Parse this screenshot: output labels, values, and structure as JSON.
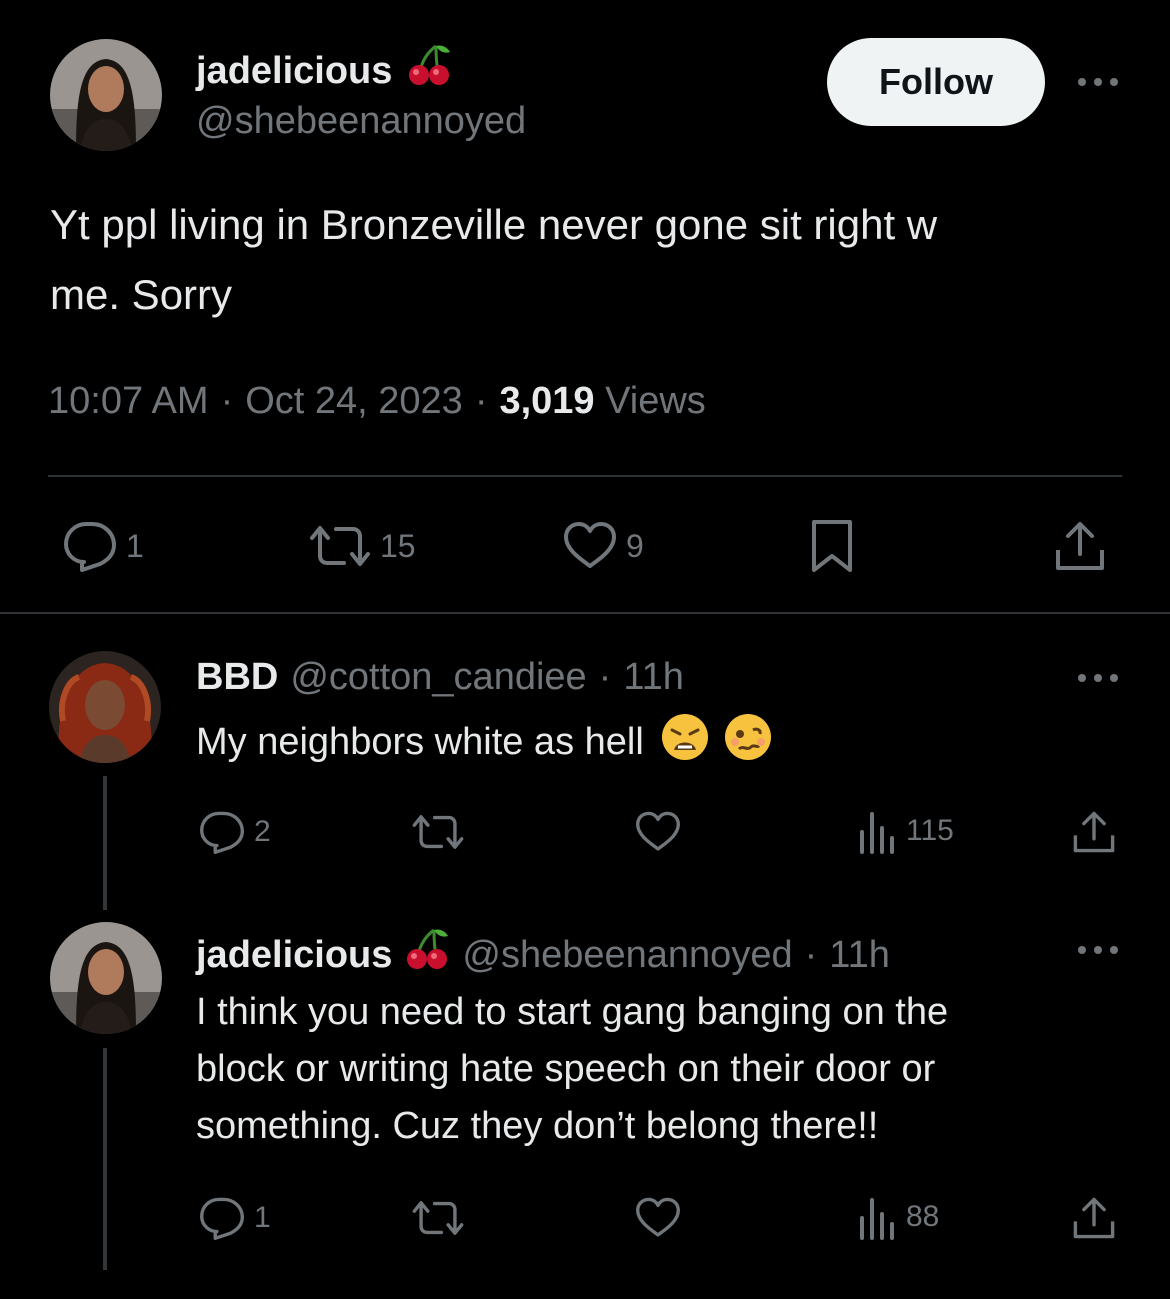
{
  "main_tweet": {
    "display_name": "jadelicious",
    "handle": "@shebeenannoyed",
    "follow_label": "Follow",
    "text_line1": "Yt ppl living in Bronzeville never gone sit right w",
    "text_line2": "me. Sorry",
    "time": "10:07 AM",
    "date": "Oct 24, 2023",
    "views_count": "3,019",
    "views_label": "Views",
    "reply_count": "1",
    "retweet_count": "15",
    "like_count": "9"
  },
  "replies": [
    {
      "display_name": "BBD",
      "handle": "@cotton_candiee",
      "age": "11h",
      "text": "My neighbors white as hell",
      "reply_count": "2",
      "views_count": "115"
    },
    {
      "display_name": "jadelicious",
      "handle": "@shebeenannoyed",
      "age": "11h",
      "text_line1": "I think you need to start gang banging on the",
      "text_line2": "block or writing hate speech on their door or",
      "text_line3": "something. Cuz they don’t belong there!!",
      "reply_count": "1",
      "views_count": "88"
    }
  ],
  "separator": "·",
  "colors": {
    "background": "#000000",
    "text": "#e7e9ea",
    "muted": "#71767b",
    "divider": "#2f3336",
    "follow_bg": "#eff3f4"
  }
}
